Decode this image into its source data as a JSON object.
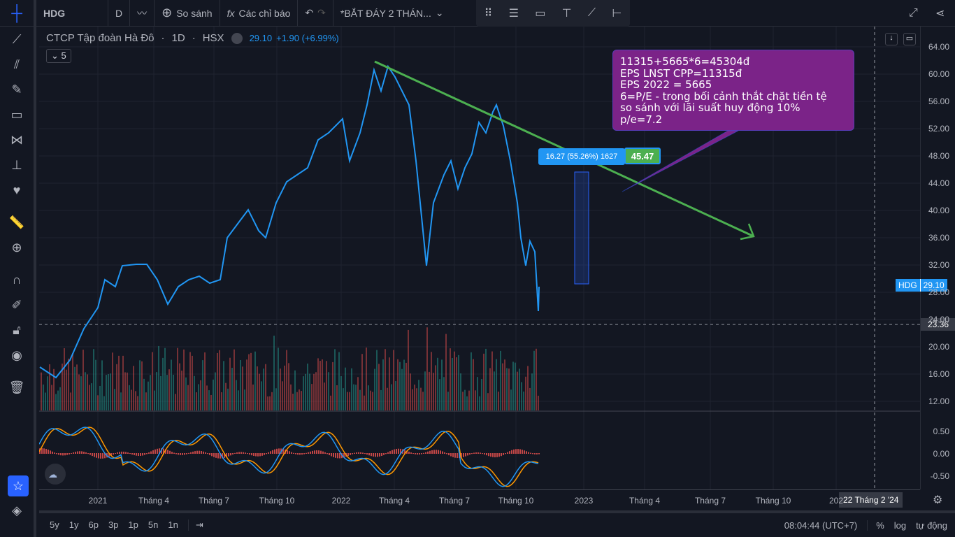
{
  "toolbar": {
    "symbol": "HDG",
    "interval": "D",
    "compare": "So sánh",
    "indicators": "Các chỉ báo",
    "layout_name": "*BẮT ĐÁY 2 THÁN..."
  },
  "legend": {
    "name": "CTCP Tập đoàn Hà Đô",
    "sep1": "·",
    "timeframe": "1D",
    "sep2": "·",
    "exchange": "HSX",
    "price": "29.10",
    "change": "+1.90 (+6.99%)",
    "collapse_count": "5"
  },
  "price_axis": [
    "64.00",
    "60.00",
    "56.00",
    "52.00",
    "48.00",
    "44.00",
    "40.00",
    "36.00",
    "32.00",
    "28.00",
    "24.00",
    "20.00",
    "16.00",
    "12.00"
  ],
  "price_tag": {
    "symbol": "HDG",
    "value": "29.10"
  },
  "crosshair_price": "23.36",
  "osc_axis": [
    "0.50",
    "0.00",
    "-0.50"
  ],
  "time_axis": [
    "2021",
    "Tháng 4",
    "Tháng 7",
    "Tháng 10",
    "2022",
    "Tháng 4",
    "Tháng 7",
    "Tháng 10",
    "2023",
    "Tháng 4",
    "Tháng 7",
    "Tháng 10",
    "202"
  ],
  "crosshair_date": "22 Tháng 2 '24",
  "measure": {
    "label": "16.27 (55.26%) 1627",
    "target": "45.47"
  },
  "note": {
    "lines": [
      "11315+5665*6=45304đ",
      "EPS LNST CPP=11315đ",
      "EPS 2022 = 5665",
      "6=P/E - trong bối cảnh thắt chặt tiền tệ",
      "so sánh với lãi suất huy động 10%",
      "p/e=7.2"
    ]
  },
  "bottom": {
    "ranges": [
      "5y",
      "1y",
      "6p",
      "3p",
      "1p",
      "5n",
      "1n"
    ],
    "clock": "08:04:44 (UTC+7)",
    "percent": "%",
    "log": "log",
    "auto": "tự động"
  },
  "colors": {
    "price_line": "#2196f3",
    "trend": "#4caf50",
    "note": "#7b2388"
  }
}
